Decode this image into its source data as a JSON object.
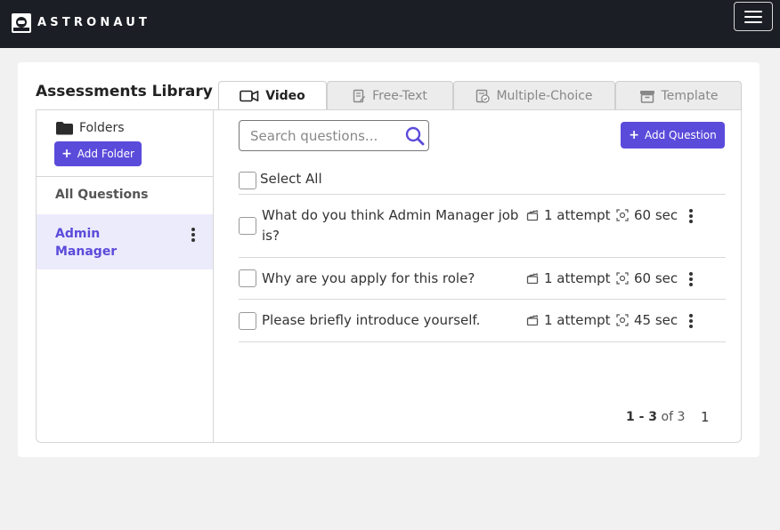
{
  "app": {
    "brand": "ASTRONAUT"
  },
  "library": {
    "title": "Assessments Library"
  },
  "tabs": [
    {
      "label": "Video",
      "icon": "video-camera-icon",
      "active": true
    },
    {
      "label": "Free-Text",
      "icon": "document-edit-icon",
      "active": false
    },
    {
      "label": "Multiple-Choice",
      "icon": "list-check-icon",
      "active": false
    },
    {
      "label": "Template",
      "icon": "box-archive-icon",
      "active": false
    }
  ],
  "sidebar": {
    "folders_label": "Folders",
    "add_folder_label": "Add Folder",
    "all_questions_label": "All Questions",
    "items": [
      {
        "label": "Admin Manager",
        "selected": true
      }
    ]
  },
  "toolbar": {
    "search_placeholder": "Search questions...",
    "add_question_label": "Add Question"
  },
  "list": {
    "select_all_label": "Select All",
    "questions": [
      {
        "text": "What do you think Admin Manager job is?",
        "attempts": "1 attempt",
        "duration": "60 sec"
      },
      {
        "text": "Why are you apply for this role?",
        "attempts": "1 attempt",
        "duration": "60 sec"
      },
      {
        "text": "Please briefly introduce yourself.",
        "attempts": "1 attempt",
        "duration": "45 sec"
      }
    ]
  },
  "pagination": {
    "range": "1 - 3",
    "of_label": "of 3",
    "current_page": "1"
  },
  "colors": {
    "accent": "#5b4bdb",
    "topbar": "#1b1e24",
    "selected_bg": "#ecebfb"
  }
}
